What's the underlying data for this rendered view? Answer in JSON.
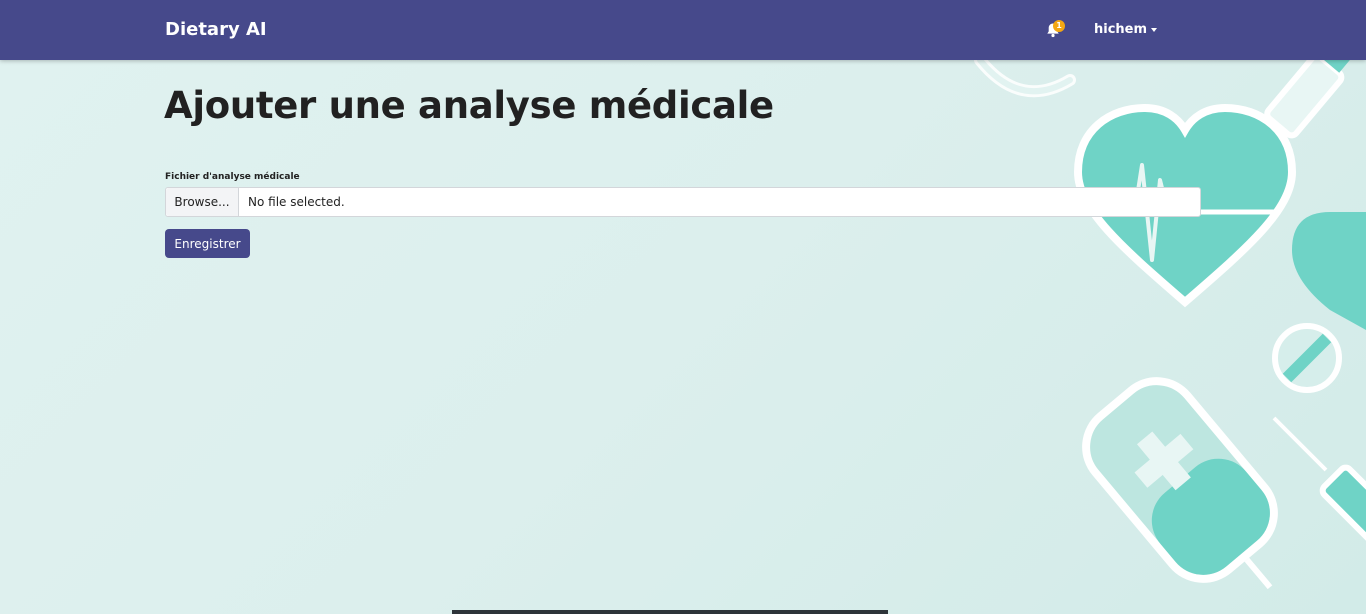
{
  "navbar": {
    "brand": "Dietary AI",
    "notifications": {
      "icon": "bell-icon",
      "count": "1"
    },
    "user": {
      "name": "hichem",
      "icon": "caret-down-icon"
    }
  },
  "main": {
    "title": "Ajouter une analyse médicale",
    "form": {
      "file_label": "Fichier d'analyse médicale",
      "browse_label": "Browse...",
      "file_status": "No file selected.",
      "submit_label": "Enregistrer"
    }
  },
  "colors": {
    "navbar": "#46498b",
    "accent": "#46498b",
    "badge": "#f3a712",
    "decoration_teal": "#6fd3c6",
    "background": "#dcefed"
  }
}
